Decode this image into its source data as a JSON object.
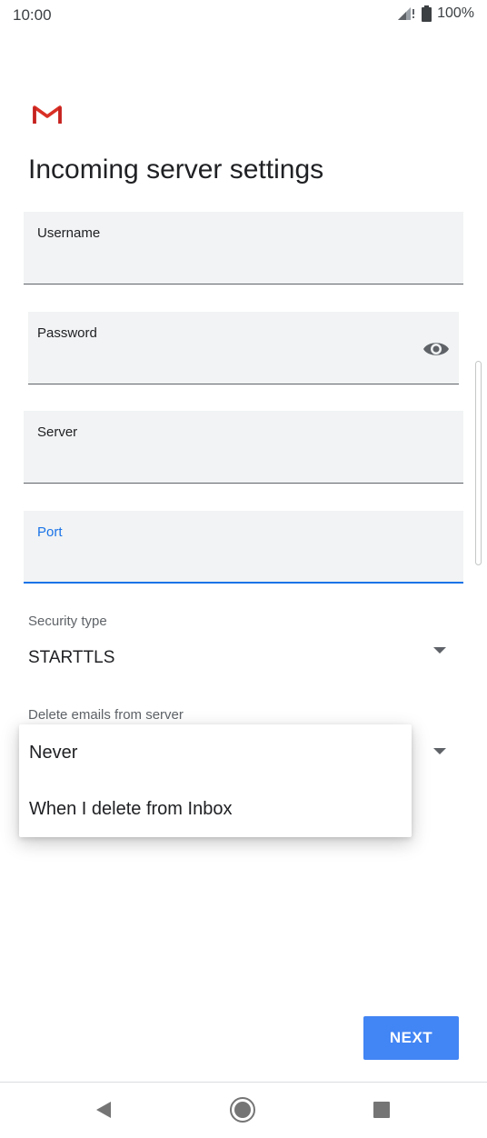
{
  "status_bar": {
    "time": "10:00",
    "battery": "100%"
  },
  "header": {
    "title": "Incoming server settings"
  },
  "fields": {
    "username": {
      "label": "Username",
      "value": ""
    },
    "password": {
      "label": "Password",
      "value": ""
    },
    "server": {
      "label": "Server",
      "value": ""
    },
    "port": {
      "label": "Port",
      "value": ""
    }
  },
  "security": {
    "label": "Security type",
    "value": "STARTTLS"
  },
  "delete_emails": {
    "label": "Delete emails from server"
  },
  "popup_menu": {
    "items": [
      {
        "label": "Never"
      },
      {
        "label": "When I delete from Inbox"
      }
    ]
  },
  "footer": {
    "next_label": "NEXT"
  },
  "colors": {
    "accent": "#4285f4",
    "active_field": "#1a73e8",
    "field_bg": "#f1f3f4",
    "gmail_red": "#d93025"
  },
  "icons": {
    "logo": "gmail-logo",
    "password_toggle": "eye-icon",
    "signal": "signal-icon",
    "battery": "battery-icon",
    "nav_back": "back-triangle-icon",
    "nav_home": "home-circle-icon",
    "nav_recents": "recents-square-icon"
  }
}
